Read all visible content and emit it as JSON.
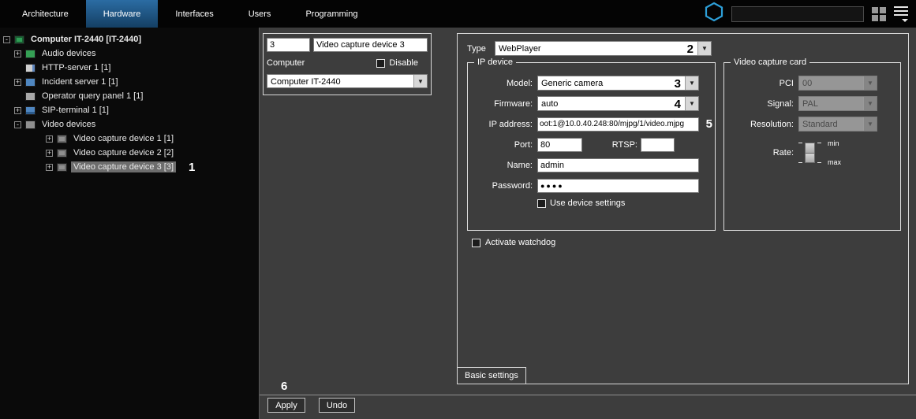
{
  "header": {
    "menu": [
      {
        "label": "Architecture"
      },
      {
        "label": "Hardware"
      },
      {
        "label": "Interfaces"
      },
      {
        "label": "Users"
      },
      {
        "label": "Programming"
      }
    ],
    "search": {
      "value": ""
    }
  },
  "tree": {
    "items": [
      {
        "label": "Computer IT-2440 [IT-2440]",
        "expander": "-"
      },
      {
        "label": "Audio devices",
        "expander": "+"
      },
      {
        "label": "HTTP-server 1 [1]",
        "expander": ""
      },
      {
        "label": "Incident server 1 [1]",
        "expander": "+"
      },
      {
        "label": "Operator query panel 1 [1]",
        "expander": ""
      },
      {
        "label": "SIP-terminal 1 [1]",
        "expander": "+"
      },
      {
        "label": "Video devices",
        "expander": "-"
      },
      {
        "label": "Video capture device 1 [1]",
        "expander": "+"
      },
      {
        "label": "Video capture device 2 [2]",
        "expander": "+"
      },
      {
        "label": "Video capture device 3 [3]",
        "expander": "+"
      }
    ]
  },
  "id_panel": {
    "number": "3",
    "name": "Video capture device 3",
    "computer_label": "Computer",
    "disable_label": "Disable",
    "computer_value": "Computer IT-2440"
  },
  "settings": {
    "type_label": "Type",
    "type_value": "WebPlayer",
    "ip_device": {
      "title": "IP device",
      "model_label": "Model:",
      "model_value": "Generic camera",
      "firmware_label": "Firmware:",
      "firmware_value": "auto",
      "ip_label": "IP address:",
      "ip_value": "oot:1@10.0.40.248:80/mjpg/1/video.mjpg",
      "port_label": "Port:",
      "port_value": "80",
      "rtsp_label": "RTSP:",
      "rtsp_value": "",
      "name_label": "Name:",
      "name_value": "admin",
      "password_label": "Password:",
      "password_value": "●●●●",
      "use_device_settings_label": "Use device settings"
    },
    "capture_card": {
      "title": "Video capture card",
      "pci_label": "PCI",
      "pci_value": "00",
      "signal_label": "Signal:",
      "signal_value": "PAL",
      "resolution_label": "Resolution:",
      "resolution_value": "Standard",
      "rate_label": "Rate:",
      "min_label": "min",
      "max_label": "max"
    },
    "watchdog_label": "Activate watchdog",
    "tab_label": "Basic settings"
  },
  "footer": {
    "apply_label": "Apply",
    "undo_label": "Undo"
  },
  "annotations": {
    "n1": "1",
    "n2": "2",
    "n3": "3",
    "n4": "4",
    "n5": "5",
    "n6": "6"
  },
  "colors": {
    "active_tab_blue": "#1c5380",
    "logo_blue": "#2d9fd8",
    "selection_gray": "#6d6d6d",
    "panel_gray": "#3d3d3d"
  }
}
